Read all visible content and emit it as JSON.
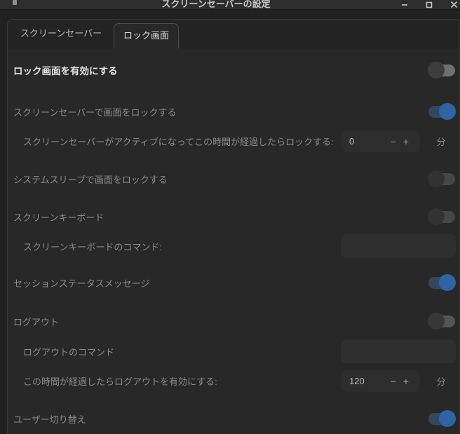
{
  "titlebar": {
    "title": "スクリーンセーバーの設定"
  },
  "tabs": [
    {
      "label": "スクリーンセーバー",
      "active": false
    },
    {
      "label": "ロック画面",
      "active": true
    }
  ],
  "colors": {
    "accent_toggle_knob": "#2e64a4",
    "accent_toggle_track": "#33475f",
    "window_background": "#212121",
    "content_background": "#282828"
  },
  "rows": [
    {
      "type": "toggle",
      "label": "ロック画面を有効にする",
      "state": "off"
    },
    {
      "type": "toggle",
      "label": "スクリーンセーバーで画面をロックする",
      "state": "on"
    },
    {
      "type": "spin",
      "label": "スクリーンセーバーがアクティブになってこの時間が経過したらロックする:",
      "value": "0",
      "minus": "−",
      "plus": "+",
      "unit": "分"
    },
    {
      "type": "toggle",
      "label": "システムスリープで画面をロックする",
      "state": "off-dim"
    },
    {
      "type": "toggle",
      "label": "スクリーンキーボード",
      "state": "off-dim"
    },
    {
      "type": "input",
      "label": "スクリーンキーボードのコマンド:",
      "value": ""
    },
    {
      "type": "toggle",
      "label": "セッションステータスメッセージ",
      "state": "on"
    },
    {
      "type": "toggle",
      "label": "ログアウト",
      "state": "off-mid"
    },
    {
      "type": "input",
      "label": "ログアウトのコマンド",
      "value": ""
    },
    {
      "type": "spin",
      "label": "この時間が経過したらログアウトを有効にする:",
      "value": "120",
      "minus": "−",
      "plus": "+",
      "unit": "分"
    },
    {
      "type": "toggle",
      "label": "ユーザー切り替え",
      "state": "on"
    }
  ]
}
